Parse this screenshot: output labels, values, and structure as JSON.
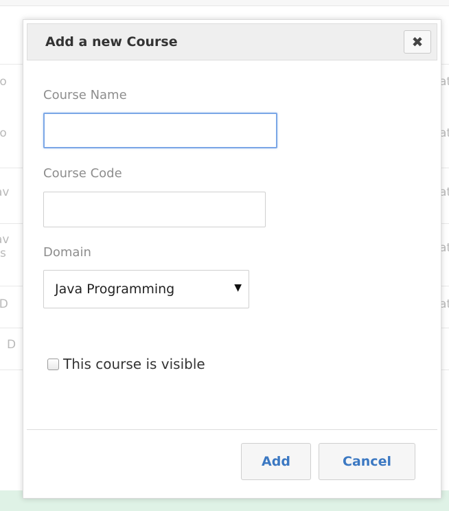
{
  "background": {
    "rows": [
      {
        "left": "tio",
        "right": "at"
      },
      {
        "left": "tio",
        "right": "at"
      },
      {
        "left": "Jav",
        "right": "at"
      },
      {
        "left": "Jav",
        "left2": "s",
        "right": "at"
      },
      {
        "left": "SD",
        "right": "at"
      },
      {
        "left": "D",
        "right": ""
      }
    ]
  },
  "dialog": {
    "title": "Add a new Course",
    "close_icon": "close-icon",
    "course_name": {
      "label": "Course Name",
      "value": "",
      "placeholder": ""
    },
    "course_code": {
      "label": "Course Code",
      "value": "",
      "placeholder": ""
    },
    "domain": {
      "label": "Domain",
      "selected": "Java Programming"
    },
    "visible_checkbox": {
      "label": "This course is visible",
      "checked": false
    },
    "add_label": "Add",
    "cancel_label": "Cancel"
  },
  "colors": {
    "accent": "#3b78c2",
    "header_bg": "#efefef",
    "focus_border": "#7aa6e6"
  }
}
